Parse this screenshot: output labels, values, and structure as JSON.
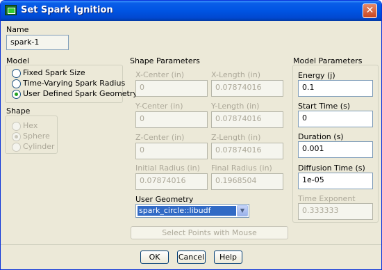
{
  "title": "Set Spark Ignition",
  "name": {
    "label": "Name",
    "value": "spark-1"
  },
  "model": {
    "label": "Model",
    "options": [
      "Fixed Spark Size",
      "Time-Varying Spark Radius",
      "User Defined Spark Geometry"
    ],
    "selected": "User Defined Spark Geometry"
  },
  "shape": {
    "label": "Shape",
    "options": [
      "Hex",
      "Sphere",
      "Cylinder"
    ],
    "selected": "Sphere",
    "enabled": false
  },
  "shape_parameters": {
    "label": "Shape Parameters",
    "x_center": {
      "label": "X-Center (in)",
      "value": "0"
    },
    "x_length": {
      "label": "X-Length (in)",
      "value": "0.07874016"
    },
    "y_center": {
      "label": "Y-Center (in)",
      "value": "0"
    },
    "y_length": {
      "label": "Y-Length (in)",
      "value": "0.07874016"
    },
    "z_center": {
      "label": "Z-Center (in)",
      "value": "0"
    },
    "z_length": {
      "label": "Z-Length (in)",
      "value": "0.07874016"
    },
    "initial_radius": {
      "label": "Initial Radius (in)",
      "value": "0.07874016"
    },
    "final_radius": {
      "label": "Final Radius (in)",
      "value": "0.1968504"
    },
    "user_geometry": {
      "label": "User Geometry",
      "value": "spark_circle::libudf"
    },
    "select_points_label": "Select Points with Mouse"
  },
  "model_parameters": {
    "label": "Model Parameters",
    "energy": {
      "label": "Energy (j)",
      "value": "0.1"
    },
    "start_time": {
      "label": "Start Time (s)",
      "value": "0"
    },
    "duration": {
      "label": "Duration (s)",
      "value": "0.001"
    },
    "diffusion_time": {
      "label": "Diffusion Time (s)",
      "value": "1e-05"
    },
    "time_exponent": {
      "label": "Time Exponent",
      "value": "0.333333"
    }
  },
  "buttons": {
    "ok": "OK",
    "cancel": "Cancel",
    "help": "Help"
  }
}
